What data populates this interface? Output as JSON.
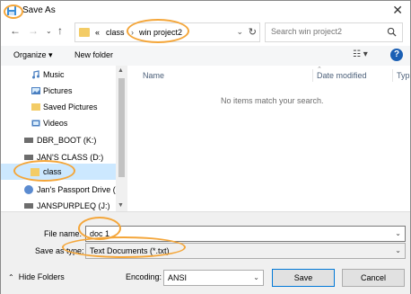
{
  "window": {
    "title": "Save As"
  },
  "address_bar": {
    "prefix": "«",
    "segments": [
      "class",
      "win project2"
    ]
  },
  "search": {
    "placeholder": "Search win project2"
  },
  "toolbar": {
    "organize": "Organize",
    "new_folder": "New folder"
  },
  "nav_pane": {
    "items": [
      {
        "label": "Music",
        "icon": "music-icon"
      },
      {
        "label": "Pictures",
        "icon": "pictures-icon"
      },
      {
        "label": "Saved Pictures",
        "icon": "folder-icon"
      },
      {
        "label": "Videos",
        "icon": "videos-icon"
      },
      {
        "label": "DBR_BOOT (K:)",
        "icon": "drive-icon"
      },
      {
        "label": "JAN'S CLASS (D:)",
        "icon": "drive-icon"
      },
      {
        "label": "class",
        "icon": "folder-icon",
        "selected": true
      },
      {
        "label": "Jan's Passport Drive (I:",
        "icon": "drive-icon"
      },
      {
        "label": "JANSPURPLEQ (J:)",
        "icon": "drive-icon"
      }
    ]
  },
  "file_list": {
    "columns": [
      "Name",
      "Date modified",
      "Typ"
    ],
    "empty_message": "No items match your search."
  },
  "form": {
    "file_name_label": "File name:",
    "file_name_value": "doc 1",
    "save_as_type_label": "Save as type:",
    "save_as_type_value": "Text Documents (*.txt)",
    "hide_folders": "Hide Folders",
    "encoding_label": "Encoding:",
    "encoding_value": "ANSI",
    "save_button": "Save",
    "cancel_button": "Cancel"
  },
  "colors": {
    "accent": "#0078d7",
    "selection": "#cce8ff",
    "highlight_circle": "#f4a63a",
    "folder": "#f3cc66"
  }
}
